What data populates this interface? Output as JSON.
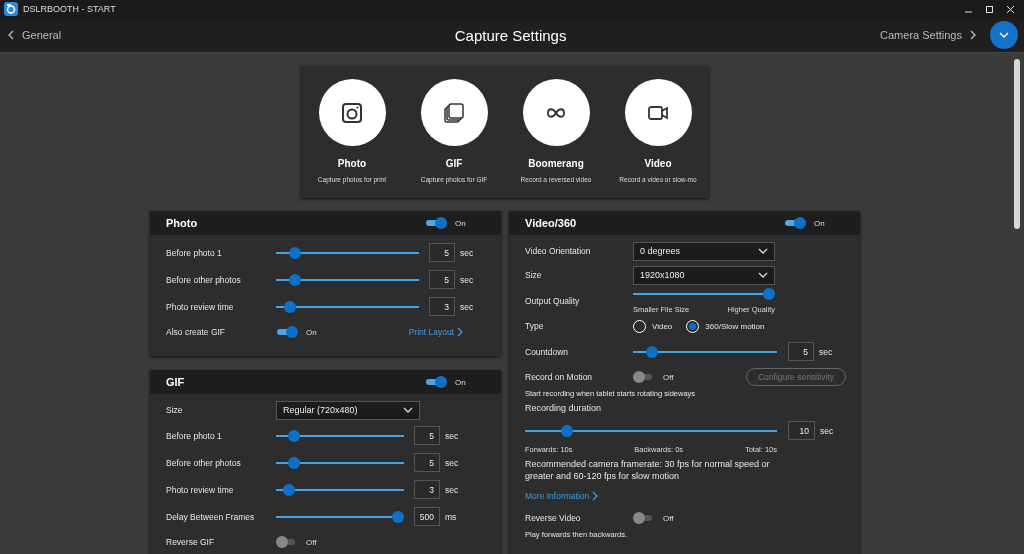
{
  "window": {
    "title": "DSLRBOOTH - START"
  },
  "header": {
    "back": "General",
    "title": "Capture Settings",
    "forward": "Camera Settings"
  },
  "modes": [
    {
      "label": "Photo",
      "description": "Capture photos for print"
    },
    {
      "label": "GIF",
      "description": "Capture photos for GIF"
    },
    {
      "label": "Boomerang",
      "description": "Record a reversed video"
    },
    {
      "label": "Video",
      "description": "Record a video or slow-mo"
    }
  ],
  "left_panels": [
    {
      "title": "Photo",
      "on": true,
      "state_label": "On",
      "rows": [
        {
          "kind": "slider",
          "label": "Before photo 1",
          "level": 0.1,
          "value": "5",
          "unit": "sec"
        },
        {
          "kind": "slider",
          "label": "Before other photos",
          "level": 0.1,
          "value": "5",
          "unit": "sec"
        },
        {
          "kind": "slider",
          "label": "Photo review time",
          "level": 0.06,
          "value": "3",
          "unit": "sec"
        },
        {
          "kind": "toggle",
          "label": "Also create GIF",
          "on": true,
          "state_label": "On",
          "link": "Print Layout"
        }
      ]
    },
    {
      "title": "GIF",
      "on": true,
      "state_label": "On",
      "rows": [
        {
          "kind": "dropdown",
          "label": "Size",
          "value": "Regular (720x480)"
        },
        {
          "kind": "slider",
          "label": "Before photo 1",
          "level": 0.1,
          "value": "5",
          "unit": "sec"
        },
        {
          "kind": "slider",
          "label": "Before other photos",
          "level": 0.1,
          "value": "5",
          "unit": "sec"
        },
        {
          "kind": "slider",
          "label": "Photo review time",
          "level": 0.06,
          "value": "3",
          "unit": "sec"
        },
        {
          "kind": "slider",
          "label": "Delay Between Frames",
          "level": 1,
          "value": "500",
          "unit": "ms"
        },
        {
          "kind": "toggle",
          "label": "Reverse GIF",
          "on": false,
          "state_label": "Off"
        }
      ]
    }
  ],
  "video_panel": {
    "title": "Video/360",
    "on": true,
    "state_label": "On",
    "rows": [
      {
        "kind": "dropdown",
        "label": "Video Orientation",
        "value": "0 degrees"
      },
      {
        "kind": "dropdown",
        "label": "Size",
        "value": "1920x1080"
      },
      {
        "kind": "quality",
        "label": "Output Quality",
        "level": 1,
        "min_label": "Smaller File Size",
        "max_label": "Higher Quality"
      },
      {
        "kind": "radio",
        "label": "Type",
        "options": [
          {
            "label": "Video",
            "selected": false
          },
          {
            "label": "360/Slow motion",
            "selected": true
          }
        ]
      },
      {
        "kind": "slider",
        "label": "Countdown",
        "level": 0.1,
        "value": "5",
        "unit": "sec"
      },
      {
        "kind": "toggle",
        "label": "Record on Motion",
        "on": false,
        "state_label": "Off",
        "button": {
          "label": "Configure sensitivity",
          "disabled": true
        },
        "note": "Start recording when tablet starts rotating sideways"
      },
      {
        "kind": "heading",
        "label": "Recording duration"
      },
      {
        "kind": "duration",
        "level": 0.15,
        "value": "10",
        "unit": "sec",
        "captions": [
          "Forwards: 10s",
          "Backwards: 0s",
          "Total: 10s"
        ]
      },
      {
        "kind": "text",
        "label": "Recommended camera framerate: 30 fps for normal speed or greater and 60-120 fps for slow motion"
      },
      {
        "kind": "link",
        "label": "More Information"
      },
      {
        "kind": "toggle",
        "label": "Reverse Video",
        "on": false,
        "state_label": "Off",
        "note": "Play forwards then backwards."
      }
    ]
  }
}
